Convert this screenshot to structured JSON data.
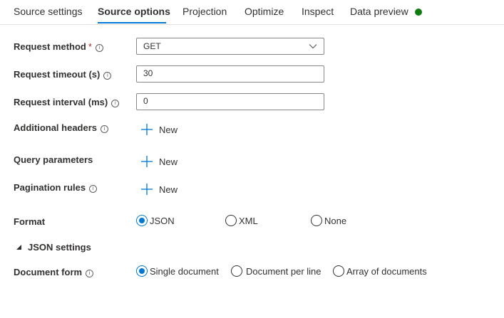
{
  "tabs": [
    {
      "label": "Source settings"
    },
    {
      "label": "Source options"
    },
    {
      "label": "Projection"
    },
    {
      "label": "Optimize"
    },
    {
      "label": "Inspect"
    },
    {
      "label": "Data preview"
    }
  ],
  "active_tab": "Source options",
  "status_color": "#107c10",
  "accent_color": "#0078d4",
  "form": {
    "request_method": {
      "label": "Request method",
      "required_mark": "*",
      "value": "GET"
    },
    "request_timeout": {
      "label": "Request timeout (s)",
      "value": "30"
    },
    "request_interval": {
      "label": "Request interval (ms)",
      "value": "0"
    },
    "additional_headers": {
      "label": "Additional headers",
      "button": "New"
    },
    "query_parameters": {
      "label": "Query parameters",
      "button": "New"
    },
    "pagination_rules": {
      "label": "Pagination rules",
      "button": "New"
    },
    "format": {
      "label": "Format",
      "options": [
        "JSON",
        "XML",
        "None"
      ],
      "selected": "JSON"
    },
    "json_settings": {
      "label": "JSON settings",
      "expanded": true
    },
    "document_form": {
      "label": "Document form",
      "options": [
        "Single document",
        "Document per line",
        "Array of documents"
      ],
      "selected": "Single document"
    }
  },
  "icons": {
    "info": "info-circle-icon",
    "dropdown": "chevron-down-icon",
    "add": "plus-icon",
    "expander": "triangle-expanded-icon"
  }
}
